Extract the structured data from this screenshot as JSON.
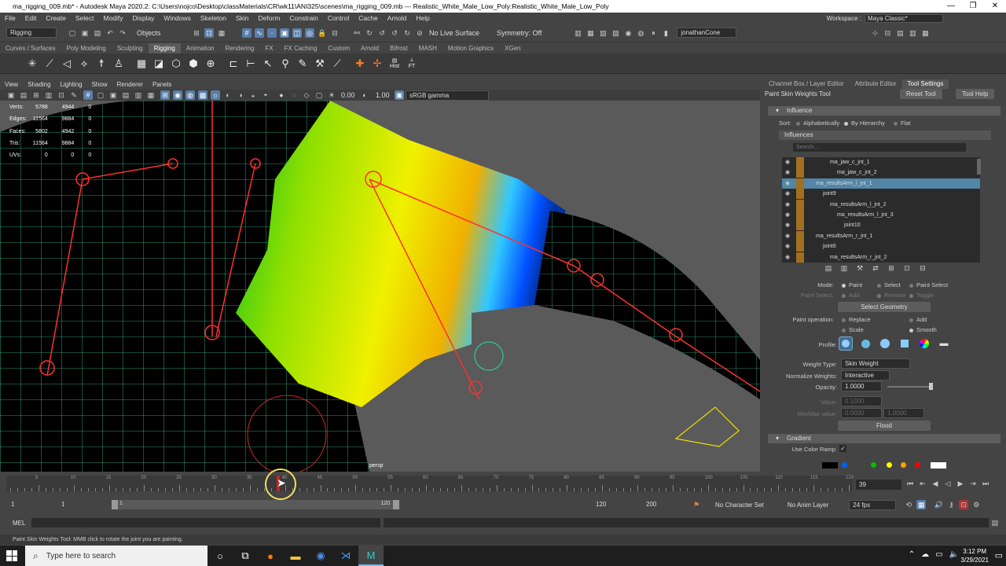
{
  "window": {
    "title": "ma_rigging_009.mb* - Autodesk Maya 2020.2: C:\\Users\\nojco\\Desktop\\classMaterials\\CR\\wk11\\ANI325\\scenes\\ma_rigging_009.mb  ---  Realistic_White_Male_Low_Poly:Realistic_White_Male_Low_Poly",
    "controls": [
      "—",
      "❐",
      "✕"
    ]
  },
  "menu": [
    "File",
    "Edit",
    "Create",
    "Select",
    "Modify",
    "Display",
    "Windows",
    "Skeleton",
    "Skin",
    "Deform",
    "Constrain",
    "Control",
    "Cache",
    "Arnold",
    "Help"
  ],
  "workspace": {
    "label": "Workspace :",
    "value": "Maya Classic*"
  },
  "status": {
    "menuset": "Rigging",
    "objects": "Objects",
    "live_surface": "No Live Surface",
    "symmetry": "Symmetry: Off",
    "user": "jonathanCone"
  },
  "shelf_tabs": [
    "Curves / Surfaces",
    "Poly Modeling",
    "Sculpting",
    "Rigging",
    "Animation",
    "Rendering",
    "FX",
    "FX Caching",
    "Custom",
    "Arnold",
    "Bifrost",
    "MASH",
    "Motion Graphics",
    "XGen"
  ],
  "shelf_active": "Rigging",
  "shelf_labels": {
    "hist": "Hist",
    "ft": "FT"
  },
  "viewport_menu": [
    "View",
    "Shading",
    "Lighting",
    "Show",
    "Renderer",
    "Panels"
  ],
  "viewport_tool": {
    "val1": "0.00",
    "val2": "1.00",
    "colorspace": "sRGB gamma"
  },
  "hud": [
    [
      "Verts:",
      "5788",
      "4944",
      "0"
    ],
    [
      "Edges:",
      "11564",
      "9884",
      "0"
    ],
    [
      "Faces:",
      "5802",
      "4942",
      "0"
    ],
    [
      "Tris:",
      "11564",
      "9884",
      "0"
    ],
    [
      "UVs:",
      "0",
      "0",
      "0"
    ]
  ],
  "camera": "persp",
  "panel": {
    "tabs": [
      "Channel Box / Layer Editor",
      "Attribute Editor",
      "Tool Settings"
    ],
    "active_tab": "Tool Settings",
    "tool_name": "Paint Skin Weights Tool",
    "reset": "Reset Tool",
    "help": "Tool Help",
    "influence_section": "Influence",
    "sort_label": "Sort:",
    "sort_options": [
      "Alphabetically",
      "By Hierarchy",
      "Flat"
    ],
    "influences_label": "Influences",
    "search_placeholder": "Search...",
    "tree": [
      {
        "name": "ma_jaw_c_jnt_1",
        "indent": 3
      },
      {
        "name": "ma_jaw_c_jnt_2",
        "indent": 4
      },
      {
        "name": "ma_resultsArm_l_jnt_1",
        "indent": 1,
        "selected": true
      },
      {
        "name": "joint9",
        "indent": 2
      },
      {
        "name": "ma_resultsArm_l_jnt_2",
        "indent": 3
      },
      {
        "name": "ma_resultsArm_l_jnt_3",
        "indent": 4
      },
      {
        "name": "joint10",
        "indent": 5
      },
      {
        "name": "ma_resultsArm_r_jnt_1",
        "indent": 1
      },
      {
        "name": "joint6",
        "indent": 2
      },
      {
        "name": "ma_resultsArm_r_jnt_2",
        "indent": 3
      },
      {
        "name": "ma_resultsArm_r_jnt_3",
        "indent": 4
      }
    ],
    "mode_label": "Mode:",
    "modes": [
      "Paint",
      "Select",
      "Paint Select"
    ],
    "paint_select_label": "Paint Select:",
    "paint_select_opts": [
      "Add",
      "Remove",
      "Toggle"
    ],
    "select_geometry": "Select Geometry",
    "paint_op_label": "Paint operation:",
    "paint_ops": [
      "Replace",
      "Add",
      "Scale",
      "Smooth"
    ],
    "profile_label": "Profile:",
    "weight_type_label": "Weight Type:",
    "weight_type": "Skin Weight",
    "normalize_label": "Normalize Weights:",
    "normalize": "Interactive",
    "opacity_label": "Opacity:",
    "opacity": "1.0000",
    "value_label": "Value:",
    "value": "0.1000",
    "minmax_label": "Min/Max value:",
    "min": "0.0000",
    "max": "1.0000",
    "flood": "Flood",
    "gradient_section": "Gradient",
    "use_color_ramp": "Use Color Ramp",
    "ramp_colors": [
      "#000000",
      "#0060ff",
      "#00c000",
      "#ffff00",
      "#ffa000",
      "#ff0000",
      "#ffffff"
    ]
  },
  "timeline": {
    "ticks": [
      "5",
      "10",
      "15",
      "20",
      "25",
      "30",
      "35",
      "40",
      "45",
      "50",
      "55",
      "60",
      "65",
      "70",
      "75",
      "80",
      "85",
      "90",
      "95",
      "100",
      "105",
      "110",
      "115",
      "120"
    ],
    "current": "39",
    "range_start": "1",
    "range_start2": "1",
    "range_inner_start": "1",
    "range_inner_end": "120",
    "range_end": "120",
    "range_end2": "200",
    "character_set": "No Character Set",
    "anim_layer": "No Anim Layer",
    "fps": "24 fps"
  },
  "cmd": {
    "label": "MEL"
  },
  "help_line": "Paint Skin Weights Tool: MMB click to rotate the joint you are painting.",
  "taskbar": {
    "search": "Type here to search",
    "time": "3:12 PM",
    "date": "3/29/2021"
  }
}
